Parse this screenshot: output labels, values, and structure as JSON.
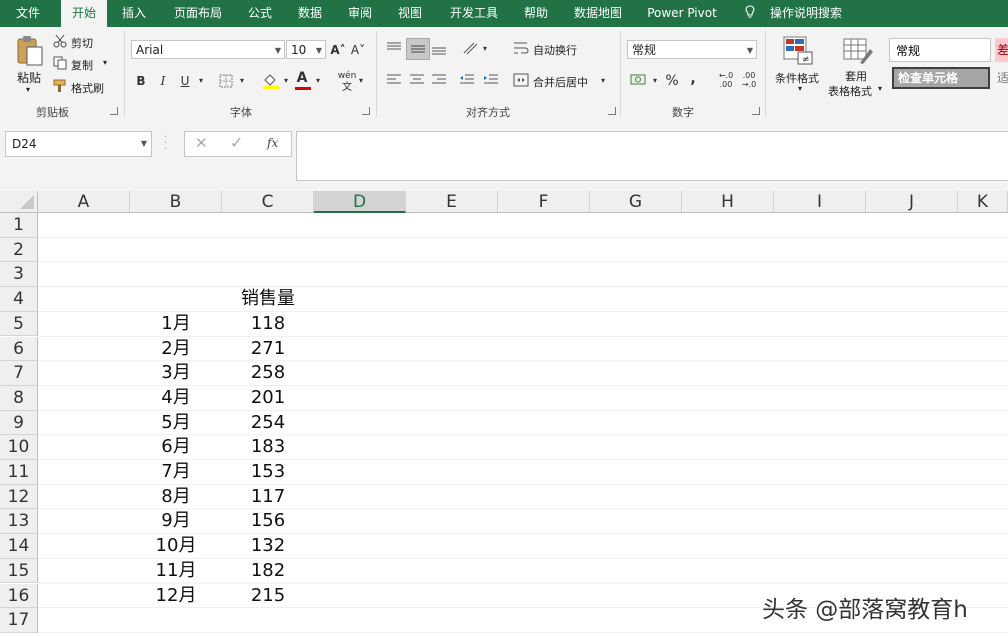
{
  "ribbon_tabs": [
    "文件",
    "开始",
    "插入",
    "页面布局",
    "公式",
    "数据",
    "审阅",
    "视图",
    "开发工具",
    "帮助",
    "数据地图",
    "Power Pivot"
  ],
  "tell_me": "操作说明搜索",
  "clipboard": {
    "paste": "粘贴",
    "cut": "剪切",
    "copy": "复制",
    "format_painter": "格式刷",
    "group": "剪贴板"
  },
  "font": {
    "name": "Arial",
    "size": "10",
    "bold": "B",
    "italic": "I",
    "underline": "U",
    "group": "字体",
    "grow": "A˄",
    "shrink": "A˅",
    "phonetic": "wén",
    "phonetic_sub": "文"
  },
  "alignment": {
    "wrap": "自动换行",
    "merge": "合并后居中",
    "group": "对齐方式"
  },
  "number": {
    "format": "常规",
    "percent": "%",
    "comma": ",",
    "group": "数字",
    "inc_decimal": "←.0 .00",
    "dec_decimal": ".00 →.0"
  },
  "styles": {
    "conditional": "条件格式",
    "table_format_1": "套用",
    "table_format_2": "表格格式",
    "normal": "常规",
    "check_cell": "检查单元格",
    "bad_partial": "差",
    "neutral_partial": "适"
  },
  "name_box": "D24",
  "fx": "fx",
  "columns": [
    "A",
    "B",
    "C",
    "D",
    "E",
    "F",
    "G",
    "H",
    "I",
    "J",
    "K"
  ],
  "selected_column": "D",
  "rows": [
    "1",
    "2",
    "3",
    "4",
    "5",
    "6",
    "7",
    "8",
    "9",
    "10",
    "11",
    "12",
    "13",
    "14",
    "15",
    "16",
    "17"
  ],
  "sheet": {
    "header": "销售量",
    "months": [
      "1月",
      "2月",
      "3月",
      "4月",
      "5月",
      "6月",
      "7月",
      "8月",
      "9月",
      "10月",
      "11月",
      "12月"
    ],
    "sales": [
      118,
      271,
      258,
      201,
      254,
      183,
      153,
      117,
      156,
      132,
      182,
      215
    ]
  },
  "watermark": "头条 @部落窝教育h"
}
